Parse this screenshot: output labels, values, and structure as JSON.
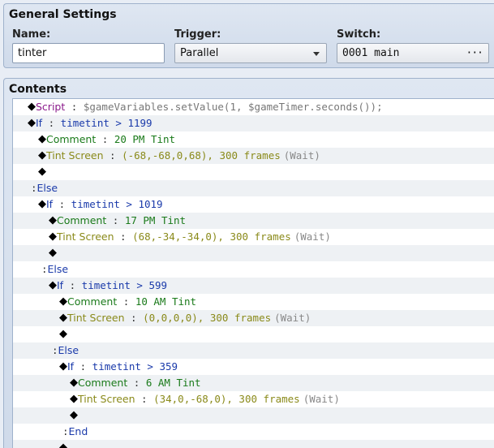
{
  "general": {
    "title": "General Settings",
    "name_label": "Name:",
    "name_value": "tinter",
    "trigger_label": "Trigger:",
    "trigger_value": "Parallel",
    "switch_label": "Switch:",
    "switch_value": "0001 main",
    "switch_button": "···"
  },
  "contents": {
    "title": "Contents",
    "rows": [
      {
        "indent": 0,
        "alt": false,
        "diamond": true,
        "cmd": "Script",
        "cls": "c-script",
        "colon": true,
        "arg": "$gameVariables.setValue(1, $gameTimer.seconds());",
        "argcls": "c-script-text",
        "wait": ""
      },
      {
        "indent": 0,
        "alt": true,
        "diamond": true,
        "cmd": "If",
        "cls": "c-if",
        "colon": true,
        "arg": "timetint > 1199",
        "argcls": "c-if t-mono",
        "wait": ""
      },
      {
        "indent": 1,
        "alt": false,
        "diamond": true,
        "cmd": "Comment",
        "cls": "c-comment",
        "colon": true,
        "arg": "20 PM Tint",
        "argcls": "c-comment t-mono",
        "wait": ""
      },
      {
        "indent": 1,
        "alt": true,
        "diamond": true,
        "cmd": "Tint Screen",
        "cls": "c-tint",
        "colon": true,
        "arg": "(-68,-68,0,68), 300 frames",
        "argcls": "c-tint t-mono",
        "wait": "(Wait)"
      },
      {
        "indent": 1,
        "alt": false,
        "diamond": true,
        "cmd": "",
        "cls": "",
        "colon": false,
        "arg": "",
        "argcls": "",
        "wait": ""
      },
      {
        "indent": 0,
        "alt": true,
        "diamond": false,
        "cmd": "Else",
        "cls": "c-if",
        "colon": true,
        "arg": "",
        "argcls": "",
        "wait": ""
      },
      {
        "indent": 1,
        "alt": false,
        "diamond": true,
        "cmd": "If",
        "cls": "c-if",
        "colon": true,
        "arg": "timetint > 1019",
        "argcls": "c-if t-mono",
        "wait": ""
      },
      {
        "indent": 2,
        "alt": true,
        "diamond": true,
        "cmd": "Comment",
        "cls": "c-comment",
        "colon": true,
        "arg": "17 PM Tint",
        "argcls": "c-comment t-mono",
        "wait": ""
      },
      {
        "indent": 2,
        "alt": false,
        "diamond": true,
        "cmd": "Tint Screen",
        "cls": "c-tint",
        "colon": true,
        "arg": "(68,-34,-34,0), 300 frames",
        "argcls": "c-tint t-mono",
        "wait": "(Wait)"
      },
      {
        "indent": 2,
        "alt": true,
        "diamond": true,
        "cmd": "",
        "cls": "",
        "colon": false,
        "arg": "",
        "argcls": "",
        "wait": ""
      },
      {
        "indent": 1,
        "alt": false,
        "diamond": false,
        "cmd": "Else",
        "cls": "c-if",
        "colon": true,
        "arg": "",
        "argcls": "",
        "wait": ""
      },
      {
        "indent": 2,
        "alt": true,
        "diamond": true,
        "cmd": "If",
        "cls": "c-if",
        "colon": true,
        "arg": "timetint > 599",
        "argcls": "c-if t-mono",
        "wait": ""
      },
      {
        "indent": 3,
        "alt": false,
        "diamond": true,
        "cmd": "Comment",
        "cls": "c-comment",
        "colon": true,
        "arg": "10 AM Tint",
        "argcls": "c-comment t-mono",
        "wait": ""
      },
      {
        "indent": 3,
        "alt": true,
        "diamond": true,
        "cmd": "Tint Screen",
        "cls": "c-tint",
        "colon": true,
        "arg": "(0,0,0,0), 300 frames",
        "argcls": "c-tint t-mono",
        "wait": "(Wait)"
      },
      {
        "indent": 3,
        "alt": false,
        "diamond": true,
        "cmd": "",
        "cls": "",
        "colon": false,
        "arg": "",
        "argcls": "",
        "wait": ""
      },
      {
        "indent": 2,
        "alt": true,
        "diamond": false,
        "cmd": "Else",
        "cls": "c-if",
        "colon": true,
        "arg": "",
        "argcls": "",
        "wait": ""
      },
      {
        "indent": 3,
        "alt": false,
        "diamond": true,
        "cmd": "If",
        "cls": "c-if",
        "colon": true,
        "arg": "timetint > 359",
        "argcls": "c-if t-mono",
        "wait": ""
      },
      {
        "indent": 4,
        "alt": true,
        "diamond": true,
        "cmd": "Comment",
        "cls": "c-comment",
        "colon": true,
        "arg": "6 AM Tint",
        "argcls": "c-comment t-mono",
        "wait": ""
      },
      {
        "indent": 4,
        "alt": false,
        "diamond": true,
        "cmd": "Tint Screen",
        "cls": "c-tint",
        "colon": true,
        "arg": "(34,0,-68,0), 300 frames",
        "argcls": "c-tint t-mono",
        "wait": "(Wait)"
      },
      {
        "indent": 4,
        "alt": true,
        "diamond": true,
        "cmd": "",
        "cls": "",
        "colon": false,
        "arg": "",
        "argcls": "",
        "wait": ""
      },
      {
        "indent": 3,
        "alt": false,
        "diamond": false,
        "cmd": "End",
        "cls": "c-if",
        "colon": true,
        "arg": "",
        "argcls": "",
        "wait": ""
      },
      {
        "indent": 3,
        "alt": true,
        "diamond": true,
        "cmd": "",
        "cls": "",
        "colon": false,
        "arg": "",
        "argcls": "",
        "wait": ""
      }
    ]
  }
}
